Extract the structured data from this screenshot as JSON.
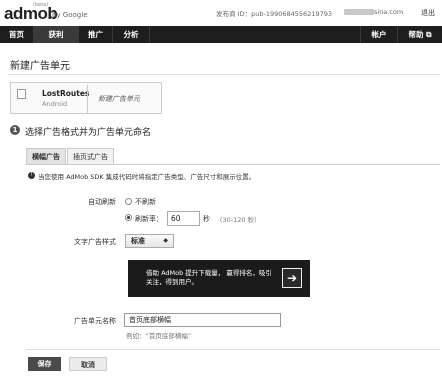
{
  "header": {
    "logo_text": "admob",
    "logo_beta": "(beta)",
    "logo_by": "by Google",
    "publisher_id_label": "发布商 ID：",
    "publisher_id": "pub-1990684556219793",
    "email_suffix": "sina.com",
    "logout": "退出"
  },
  "nav": {
    "items": [
      {
        "label": "首页"
      },
      {
        "label": "获利"
      },
      {
        "label": "推广"
      },
      {
        "label": "分析"
      }
    ],
    "account": "帐户",
    "help": "帮助 ⧉"
  },
  "page": {
    "title": "新建广告单元"
  },
  "breadcrumb": {
    "app_name": "LostRoutes",
    "platform": "Android",
    "current": "新建广告单元"
  },
  "step": {
    "number": "1",
    "title": "选择广告格式并为广告单元命名"
  },
  "tabs": [
    {
      "label": "横幅广告"
    },
    {
      "label": "插页式广告"
    }
  ],
  "info": {
    "text": "当您使用 AdMob SDK 集成代码时将指定广告类型、广告尺寸和展示位置。"
  },
  "refresh": {
    "label": "自动刷新",
    "option_none": "不刷新",
    "option_rate": "刷新率：",
    "value": "60",
    "unit": "秒",
    "hint": "（30-120 秒）"
  },
  "text_style": {
    "label": "文字广告样式",
    "selected": "标准"
  },
  "ad_preview": {
    "text": "借助 AdMob 提升下载量， 赢得排名，吸引关注，得到用户。",
    "arrow": "➔"
  },
  "ad_unit_name": {
    "label": "广告单元名称",
    "value": "首页底部横幅",
    "example": "例如：“首页底部横幅”"
  },
  "buttons": {
    "save": "保存",
    "cancel": "取消"
  }
}
